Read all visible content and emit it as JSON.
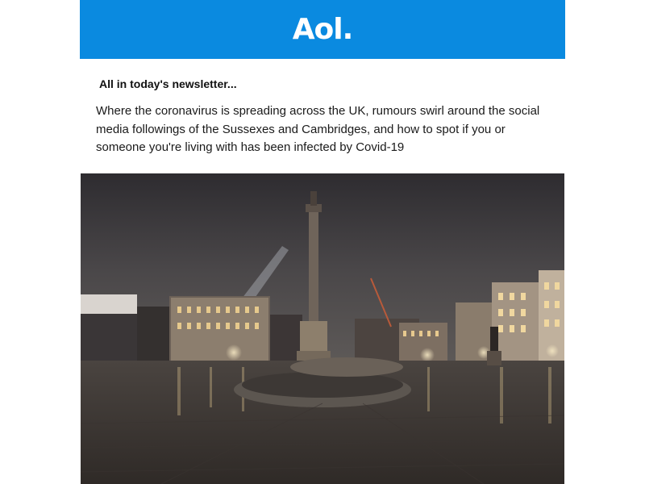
{
  "header": {
    "logo_text": "Aol.",
    "background_color": "#0a8ae0"
  },
  "intro": {
    "heading": "All in today's newsletter...",
    "body": "Where the coronavirus is spreading across the UK, rumours swirl around the social media followings of the Sussexes and Cambridges, and how to spot if you or someone you're living with has been infected by Covid-19"
  },
  "hero_image": {
    "subject": "night-photo-trafalgar-square-nelsons-column"
  }
}
